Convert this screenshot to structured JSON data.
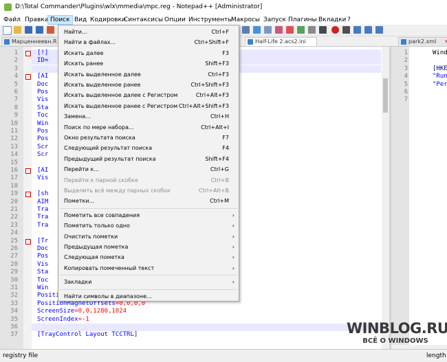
{
  "window": {
    "title": "D:\\Total Commander\\Plugins\\wlx\\mmedia\\mpc.reg - Notepad++ [Administrator]"
  },
  "menubar": {
    "items": [
      "Файл",
      "Правка",
      "Поиск",
      "Вид",
      "Кодировки",
      "Синтаксисы",
      "Опции",
      "Инструменты",
      "Макросы",
      "Запуск",
      "Плагины",
      "Вкладки",
      "?"
    ],
    "active_index": 2
  },
  "tabs": [
    {
      "label": "Марценнеевн.R"
    },
    {
      "label": "Half-Life 2.acs2.ini"
    },
    {
      "label": "park2.xml"
    }
  ],
  "dropdown": {
    "items": [
      {
        "label": "Найти...",
        "shortcut": "Ctrl+F"
      },
      {
        "label": "Найти в файлах...",
        "shortcut": "Ctrl+Shift+F"
      },
      {
        "label": "Искать далее",
        "shortcut": "F3"
      },
      {
        "label": "Искать ранее",
        "shortcut": "Shift+F3"
      },
      {
        "label": "Искать выделенное далее",
        "shortcut": "Ctrl+F3"
      },
      {
        "label": "Искать выделенное ранее",
        "shortcut": "Ctrl+Shift+F3"
      },
      {
        "label": "Искать выделенное далее с Регистром",
        "shortcut": "Ctrl+Alt+F3"
      },
      {
        "label": "Искать выделенное ранее с Регистром",
        "shortcut": "Ctrl+Alt+Shift+F3"
      },
      {
        "label": "Замена...",
        "shortcut": "Ctrl+H"
      },
      {
        "label": "Поиск по мере набора...",
        "shortcut": "Ctrl+Alt+I"
      },
      {
        "label": "Окно результата поиска",
        "shortcut": "F7"
      },
      {
        "label": "Следующий результат поиска",
        "shortcut": "F4"
      },
      {
        "label": "Предыдущий результат поиска",
        "shortcut": "Shift+F4"
      },
      {
        "label": "Перейти к...",
        "shortcut": "Ctrl+G"
      },
      {
        "label": "Перейти к парной скобке",
        "shortcut": "Ctrl+B"
      },
      {
        "label": "Выделить всё между парных скобок",
        "shortcut": "Ctrl+Alt+B"
      },
      {
        "label": "Пометки...",
        "shortcut": "Ctrl+M"
      },
      {
        "label": "Пометить все совпадения",
        "shortcut": ""
      },
      {
        "label": "Пометить только одно",
        "shortcut": ""
      },
      {
        "label": "Очистить пометки",
        "shortcut": ""
      },
      {
        "label": "Предыдущая пометка",
        "shortcut": ""
      },
      {
        "label": "Следующая пометка",
        "shortcut": ""
      },
      {
        "label": "Копировать помеченный текст",
        "shortcut": ""
      },
      {
        "label": "Закладки",
        "shortcut": ""
      },
      {
        "label": "Найти символы в диапазоне...",
        "shortcut": ""
      }
    ]
  },
  "editor": {
    "line_numbers": [
      "1",
      "2",
      "3",
      "4",
      "5",
      "6",
      "7",
      "8",
      "9",
      "10",
      "11",
      "12",
      "13",
      "14",
      "15",
      "16",
      "17",
      "18",
      "19",
      "20",
      "21",
      "22",
      "23",
      "24",
      "25",
      "26",
      "27",
      "28",
      "29",
      "30",
      "31",
      "32",
      "33",
      "34",
      "35",
      "36",
      "37"
    ],
    "lines": [
      {
        "a": "[!]",
        "b": ""
      },
      {
        "a": "ID=",
        "b": ""
      },
      {
        "a": "",
        "b": ""
      },
      {
        "a": "[AI",
        "b": ""
      },
      {
        "a": "Doc",
        "b": ""
      },
      {
        "a": "Pos",
        "b": ""
      },
      {
        "a": "Vis",
        "b": ""
      },
      {
        "a": "Sta",
        "b": ""
      },
      {
        "a": "Toc",
        "b": ""
      },
      {
        "a": "Win",
        "b": ""
      },
      {
        "a": "Pos",
        "b": ""
      },
      {
        "a": "Pos",
        "b": ""
      },
      {
        "a": "Scr",
        "b": ""
      },
      {
        "a": "Scr",
        "b": ""
      },
      {
        "a": "",
        "b": ""
      },
      {
        "a": "[AI",
        "b": ""
      },
      {
        "a": "Vis",
        "b": ""
      },
      {
        "a": "",
        "b": ""
      },
      {
        "a": "[sh",
        "b": ""
      },
      {
        "a": "AIM",
        "b": ""
      },
      {
        "a": "Tra",
        "b": ""
      },
      {
        "a": "Tra",
        "b": ""
      },
      {
        "a": "Tra",
        "b": ""
      },
      {
        "a": "",
        "b": ""
      },
      {
        "a": "[Tr",
        "b": ""
      },
      {
        "a": "Doc",
        "b": ""
      },
      {
        "a": "Pos",
        "b": ""
      },
      {
        "a": "Vis",
        "b": ""
      },
      {
        "a": "Sta",
        "b": ""
      },
      {
        "a": "Toc",
        "b": ""
      },
      {
        "a": "Win",
        "b": ""
      },
      {
        "a": "PositionMagnets",
        "b": "=0,0,0,0"
      },
      {
        "a": "PositionMagnetOffsets",
        "b": "=0,0,0,0"
      },
      {
        "a": "ScreenSize",
        "b": "=0,0,1280,1024"
      },
      {
        "a": "ScreenIndex",
        "b": "=-1"
      },
      {
        "a": "",
        "b": ""
      },
      {
        "a": "[TrayControl Layout TCCTRL]",
        "b": ""
      }
    ]
  },
  "right_pane": {
    "line_numbers": [
      "1",
      "2",
      "3",
      "4",
      "5",
      "6",
      "7"
    ],
    "lines": [
      "Wind",
      "",
      "[HKE",
      "\"Run",
      "\"Per",
      "",
      ""
    ]
  },
  "status": {
    "left": "registry file",
    "right": "length :"
  },
  "watermark": {
    "line1": "WINBLOG.RU",
    "line2": "ВСЁ О WINDOWS"
  }
}
